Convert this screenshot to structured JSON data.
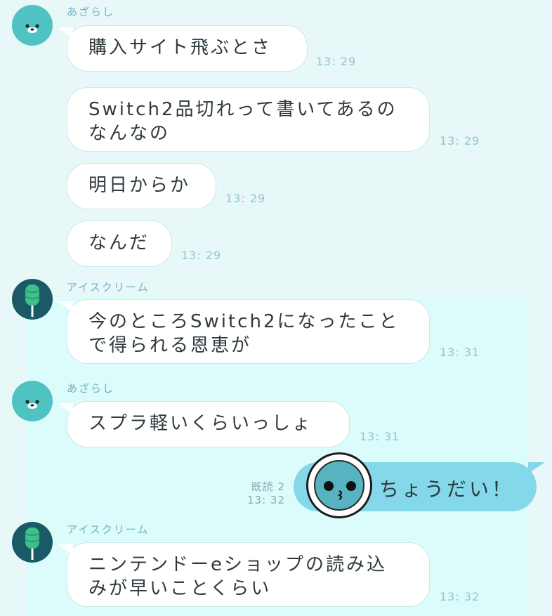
{
  "senders": {
    "seal": "あざらし",
    "ice": "アイスクリーム"
  },
  "messages": [
    {
      "text": "購入サイト飛ぶとさ",
      "time": "13: 29"
    },
    {
      "text1": "Switch2品切れって書いてあるの",
      "text2": "なんなの",
      "time": "13: 29"
    },
    {
      "text": "明日からか",
      "time": "13: 29"
    },
    {
      "text": "なんだ",
      "time": "13: 29"
    },
    {
      "text1": "今のところSwitch2になったこと",
      "text2": "で得られる恩恵が",
      "time": "13: 31"
    },
    {
      "text": "スプラ軽いくらいっしょ",
      "time": "13: 31"
    },
    {
      "text": "ちょうだい！",
      "read": "既読 2",
      "time": "13: 32"
    },
    {
      "text1": "ニンテンドーeショップの読み込",
      "text2": "みが早いことくらい",
      "time": "13: 32"
    }
  ],
  "colors": {
    "background": "#e8f7f8",
    "highlight_panel": "#dcfbfb",
    "my_bubble": "#84d8ea",
    "their_bubble": "#ffffff",
    "seal_avatar": "#4ec3c2",
    "ice_avatar": "#1a5a66"
  },
  "icons": [
    "seal-avatar-icon",
    "ice-cream-avatar-icon",
    "kiss-face-sticker-icon"
  ]
}
